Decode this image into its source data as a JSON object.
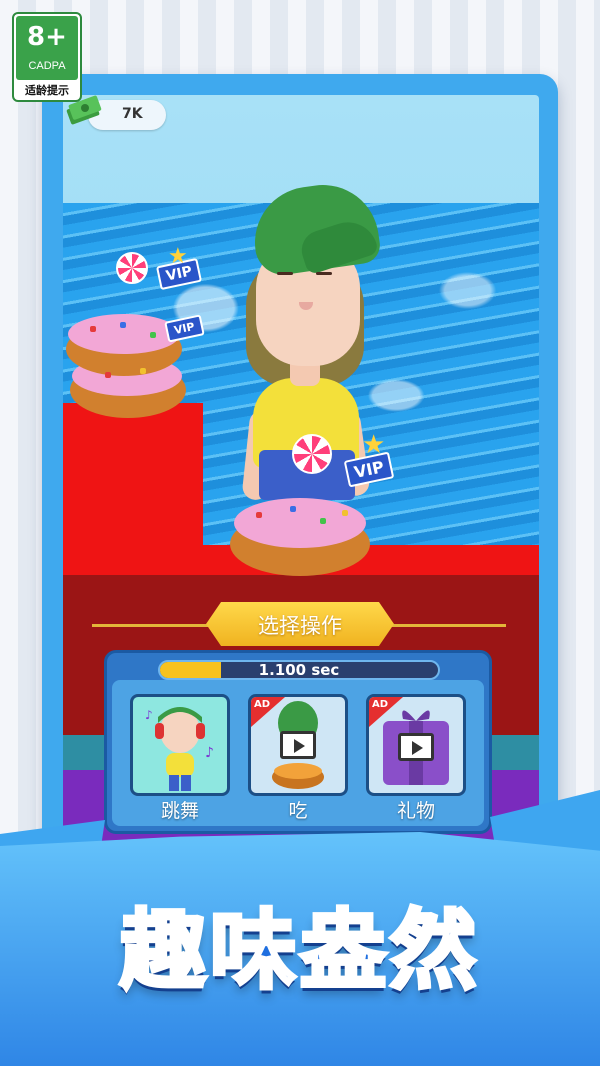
{
  "age_rating": {
    "number": "8+",
    "org": "CADPA",
    "tip": "适龄提示"
  },
  "hud": {
    "money": "7K",
    "money_icon": "cash-stack-icon"
  },
  "action_panel": {
    "title": "选择操作",
    "timer_text": "1.100 sec",
    "timer_progress_percent": 22,
    "actions": [
      {
        "label": "跳舞",
        "ad": false,
        "icon": "dancing-character-icon"
      },
      {
        "label": "吃",
        "ad": true,
        "ad_label": "AD",
        "icon": "video-play-icon"
      },
      {
        "label": "礼物",
        "ad": true,
        "ad_label": "AD",
        "icon": "video-play-icon"
      }
    ]
  },
  "scene": {
    "vip_label": "VIP"
  },
  "promo": {
    "title": "趣味盎然"
  },
  "colors": {
    "frame": "#3fa9ee",
    "panel": "#2f77c7",
    "banner": "#f7c21d",
    "ad": "#e52f2f",
    "title": "#1f6fe0"
  }
}
